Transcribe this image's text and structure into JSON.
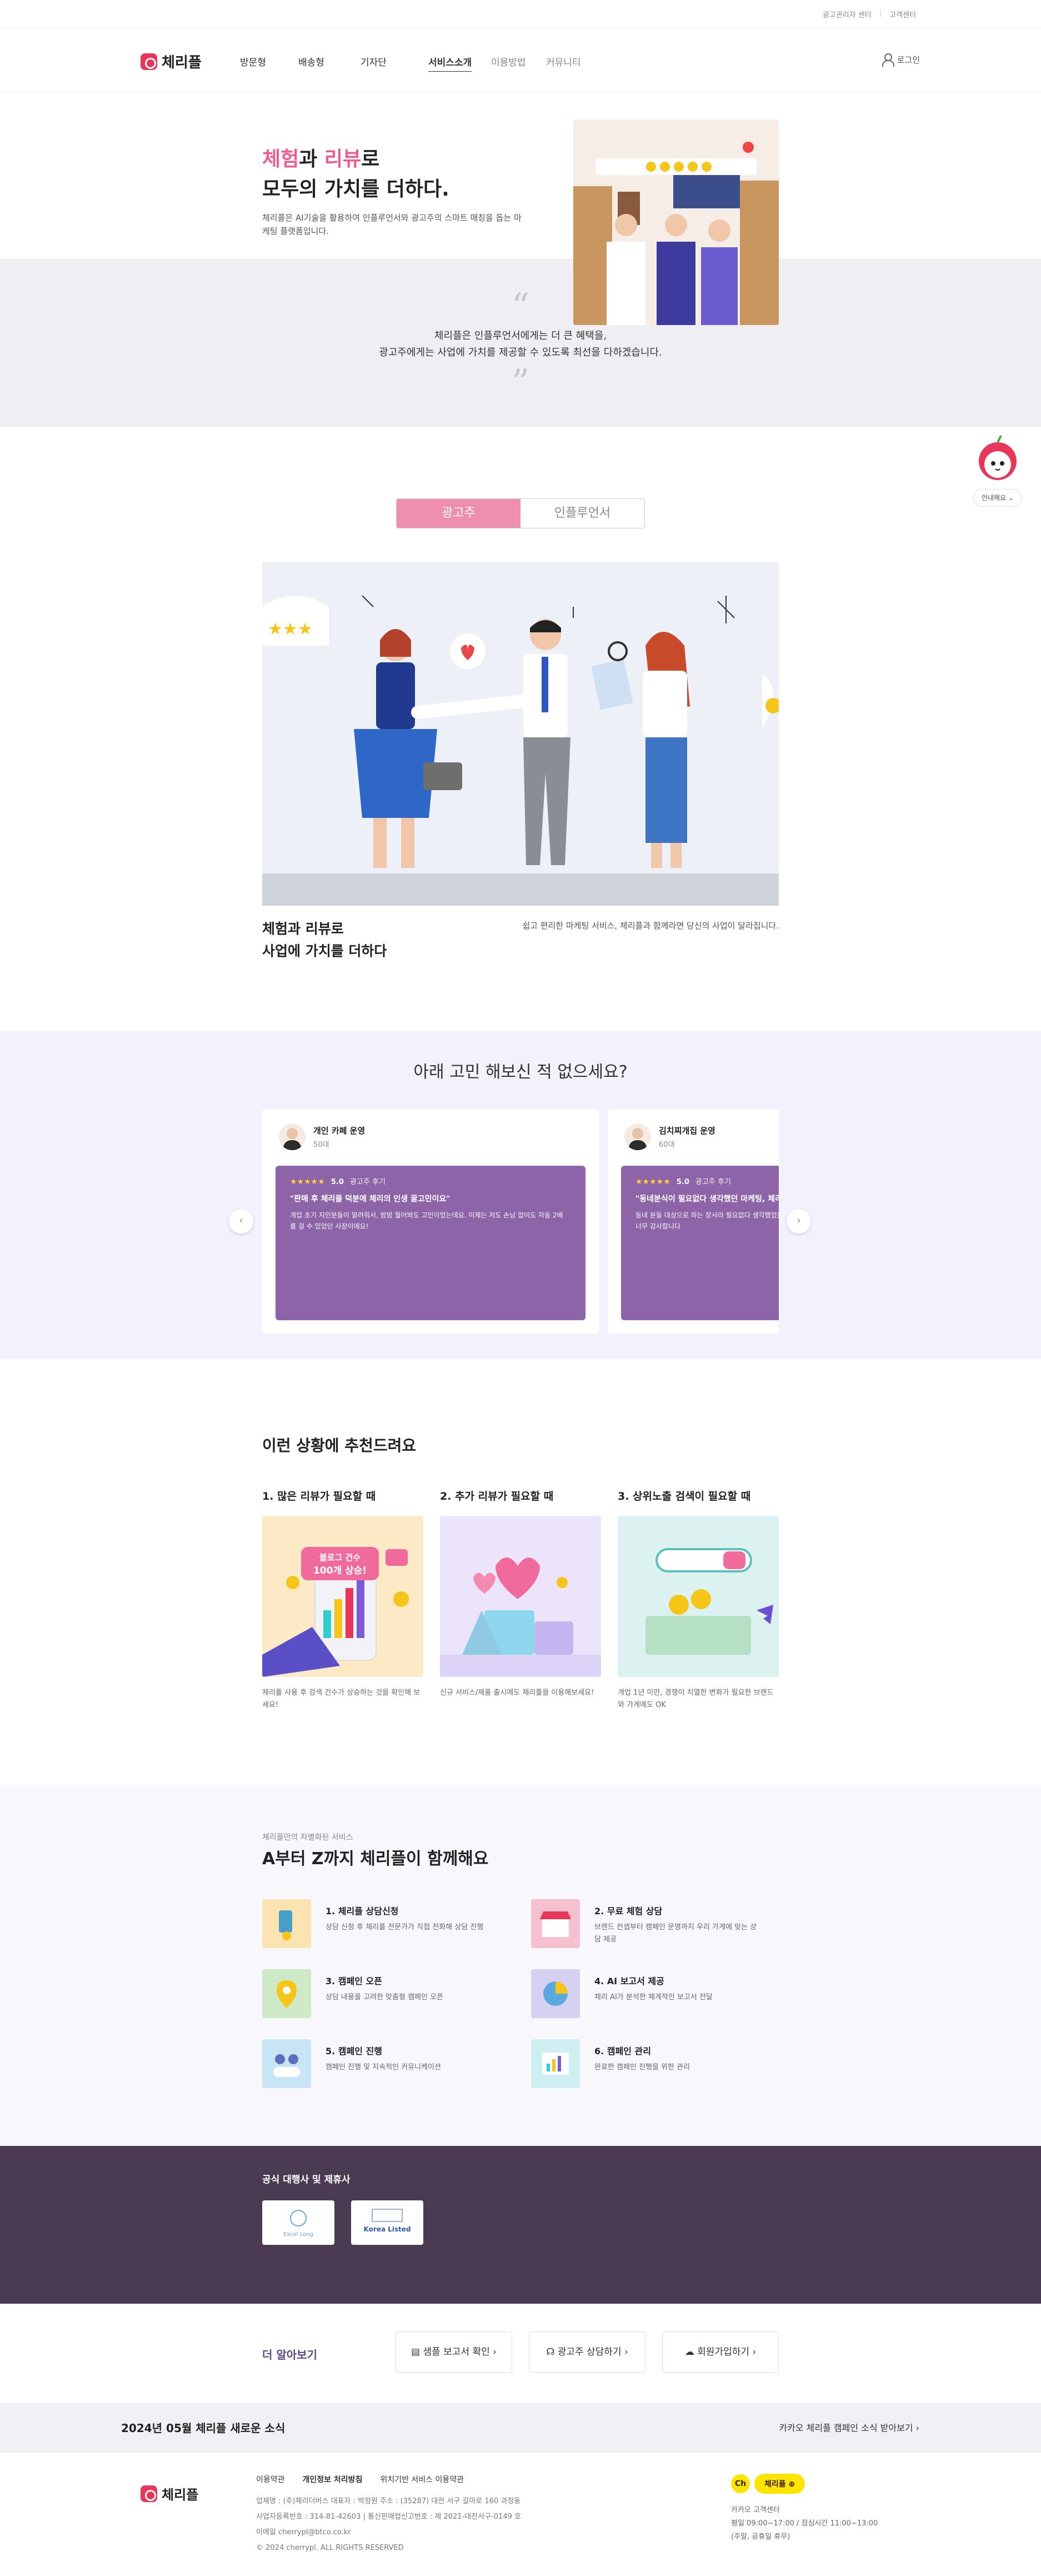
{
  "utility": {
    "links": [
      "광고관리자 센터",
      "고객센터"
    ]
  },
  "header": {
    "logo": "체리플",
    "nav": [
      "방문형",
      "배송형",
      "기자단",
      "서비스소개",
      "이용방법",
      "커뮤니티"
    ],
    "login": "로그인"
  },
  "hero": {
    "title_word1": "체험",
    "title_mid1": "과 ",
    "title_word2": "리뷰",
    "title_mid2": "로",
    "title_line2": "모두의 가치를 더하다.",
    "desc": "체리플은 AI기술을 활용하여 인플루언서와 광고주의 스마트 매칭을 돕는 마케팅 플랫폼입니다.",
    "quote_line1": "체리플은 인플루언서에게는 더 큰 혜택을,",
    "quote_line2": "광고주에게는 사업에 가치를 제공할 수 있도록 최선을 다하겠습니다."
  },
  "guide": {
    "label": "안내해요"
  },
  "tabs": [
    "광고주",
    "인플루언서"
  ],
  "advertiser": {
    "title_line1": "체험과 리뷰로",
    "title_line2": "사업에 가치를 더하다",
    "desc": "쉽고 편리한 마케팅 서비스, 체리플과 함께라면 당신의 사업이 달라집니다."
  },
  "reviews": {
    "heading": "아래 고민 해보신 적 없으세요?",
    "cards": [
      {
        "name": "개인 카페 운영",
        "age": "50대",
        "stars": "★★★★★",
        "score": "5.0",
        "label": "광고주 후기",
        "quote": "\"판매 후 체리플 덕분에 체리의 인생 꿀고민이요\"",
        "body": "개업 초기 지인분들이 알려줘서, 밤밤 뭘어봐도 고민이었는데요. 이제는 저도 손님 없이도 자동 2배 를 걸 수 있었던 사장이에요!"
      },
      {
        "name": "김치찌개집 운영",
        "age": "60대",
        "stars": "★★★★★",
        "score": "5.0",
        "label": "광고주 후기",
        "quote": "\"동네분식이 필요없다 생각했던 마케팅, 체리플\"",
        "body": "동네 분들 대상으로 하는 장사라 필요없다 생각했었는데 이 덕분에 와 각 맛있게 먹었다 알아주셔서 너무 감사합니다"
      }
    ]
  },
  "recommend": {
    "title": "이런 상황에 추천드려요",
    "items": [
      {
        "title": "1. 많은 리뷰가 필요할 때",
        "desc": "체리플 사용 후 검색 건수가 상승하는 것을 확인해 보세요!",
        "badge1": "블로그 건수",
        "badge2": "100개 상승!"
      },
      {
        "title": "2. 추가 리뷰가 필요할 때",
        "desc": "신규 서비스/제품 출시에도 체리플을 이용해보세요!"
      },
      {
        "title": "3. 상위노출 검색이 필요할 때",
        "desc": "개업 1년 미만, 경쟁이 치열한 변화가 필요한 브랜드와 가게에도 OK"
      }
    ]
  },
  "atoz": {
    "kicker": "체리플만의 차별화된 서비스",
    "title": "A부터 Z까지 체리플이 함께해요",
    "items": [
      {
        "title": "1. 체리플 상담신청",
        "desc": "상담 신청 후 체리플 전문가가 직접 전화해 상담 진행"
      },
      {
        "title": "2. 무료 체험 상담",
        "desc": "브랜드 컨셉부터 캠페인 운영까지 우리 가게에 맞는 상담 제공"
      },
      {
        "title": "3. 캠페인 오픈",
        "desc": "상담 내용을 고려한 맞춤형 캠페인 오픈"
      },
      {
        "title": "4. AI 보고서 제공",
        "desc": "체리 AI가 분석한 체계적인 보고서 전달"
      },
      {
        "title": "5. 캠페인 진행",
        "desc": "캠페인 진행 및 지속적인 커뮤니케이션"
      },
      {
        "title": "6. 캠페인 관리",
        "desc": "완료한 캠페인 진행을 위한 관리"
      }
    ]
  },
  "partners": {
    "title": "공식 대행사 및 제휴사",
    "logos": [
      "Excel Long",
      "Korea Listed"
    ]
  },
  "more": {
    "title": "더 알아보기",
    "buttons": [
      "샘플 보고서 확인 ›",
      "광고주 상담하기 ›",
      "회원가입하기 ›"
    ]
  },
  "news": {
    "left": "2024년 05월 체리플 새로운 소식",
    "right": "카카오 체리플 캠페인 소식 받아보기 ›"
  },
  "footer": {
    "logo": "체리플",
    "links": [
      "이용약관",
      "개인정보 처리방침",
      "위치기반 서비스 이용약관"
    ],
    "info": [
      "업체명 : (주)체리더버스     대표자 : 박정원     주소 : (35287) 대전 서구 갈마로 160 과정동",
      "사업자등록번호 : 314-81-42603 | 통신판매업신고번호 : 제 2021-대전서구-0149 호",
      "이메일 cherrypl@btco.co.kr",
      "© 2024 cherrypl. ALL RIGHTS RESERVED"
    ],
    "kakao_ch": "Ch",
    "kakao_label": "체리플",
    "cs": [
      "카카오 고객센터",
      "평일 09:00~17:00 / 점심시간 11:00~13:00",
      "(주말, 공휴일 휴무)"
    ]
  }
}
